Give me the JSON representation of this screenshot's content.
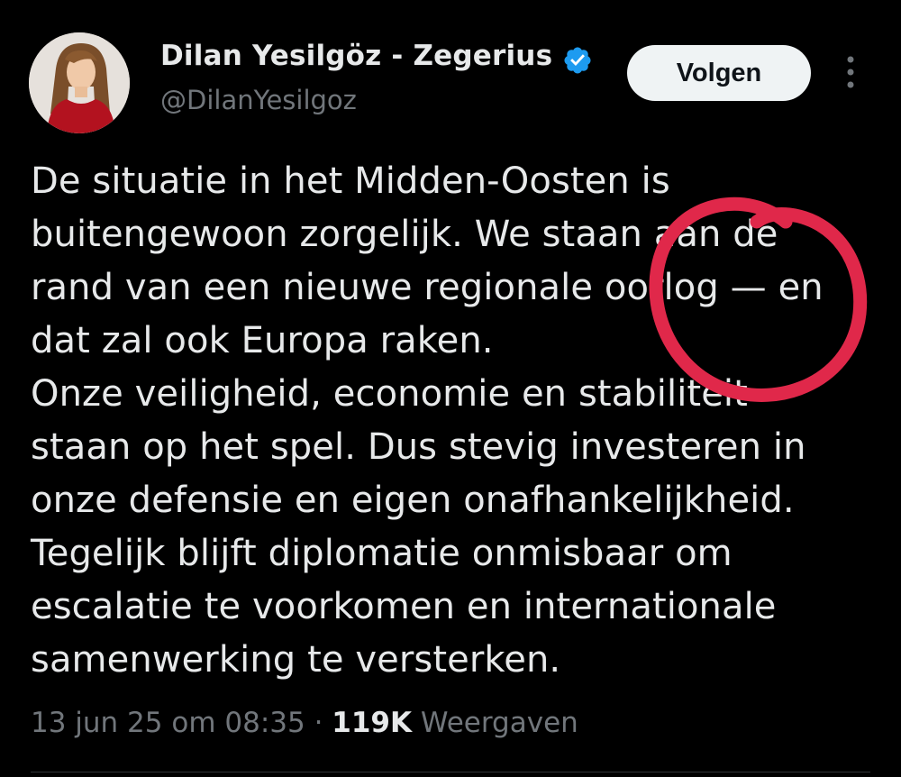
{
  "author": {
    "name": "Dilan Yesilgöz - Zegerius",
    "handle": "@DilanYesilgoz",
    "avatar_icon": "profile-photo",
    "verified_icon": "verified-badge-icon",
    "verified_color": "#1d9bf0"
  },
  "actions": {
    "follow_label": "Volgen",
    "more_icon": "more-vertical-icon"
  },
  "tweet": {
    "lines": [
      "De situatie in het Midden-Oosten is",
      "buitengewoon zorgelijk. We staan aan de",
      "rand van een nieuwe regionale oorlog — en",
      "dat zal ook Europa raken.",
      "Onze veiligheid, economie en stabiliteit",
      "staan op het spel. Dus stevig investeren in",
      "onze defensie en eigen onafhankelijkheid.",
      "Tegelijk blijft diplomatie onmisbaar om",
      "escalatie te voorkomen en internationale",
      "samenwerking te versterken."
    ]
  },
  "meta": {
    "timestamp": "13 jun 25 om 08:35",
    "separator": " · ",
    "views_count": "119K",
    "views_label": " Weergaven"
  },
  "colors": {
    "background": "#000000",
    "text": "#e7e9ea",
    "secondary_text": "#71767b",
    "annotation_circle": "#e0284a"
  }
}
